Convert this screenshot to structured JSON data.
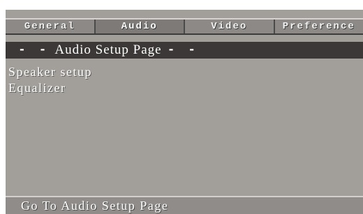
{
  "tabs": [
    {
      "label": "General"
    },
    {
      "label": "Audio"
    },
    {
      "label": "Video"
    },
    {
      "label": "Preference"
    }
  ],
  "page_title": {
    "prefix": "- -",
    "text": "Audio Setup Page",
    "suffix": "- -"
  },
  "menu": {
    "items": [
      {
        "label": "Speaker setup"
      },
      {
        "label": "Equalizer"
      }
    ]
  },
  "status": {
    "text": "Go To Audio Setup Page"
  }
}
